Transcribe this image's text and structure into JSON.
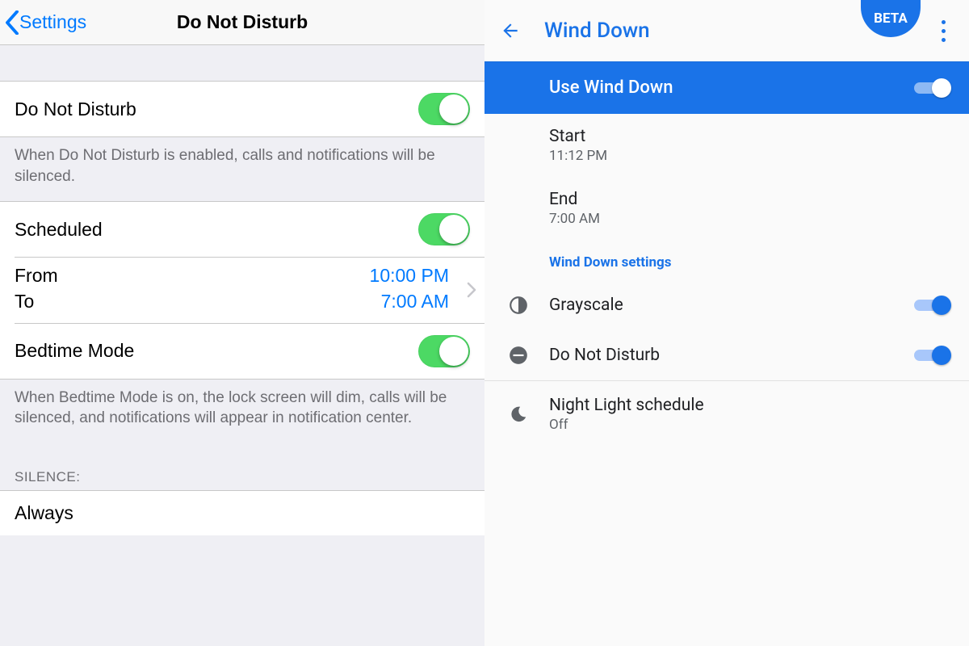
{
  "ios": {
    "back_label": "Settings",
    "title": "Do Not Disturb",
    "dnd": {
      "label": "Do Not Disturb",
      "on": true
    },
    "dnd_footer": "When Do Not Disturb is enabled, calls and notifications will be silenced.",
    "scheduled": {
      "label": "Scheduled",
      "on": true
    },
    "schedule": {
      "from_label": "From",
      "to_label": "To",
      "from": "10:00 PM",
      "to": "7:00 AM"
    },
    "bedtime": {
      "label": "Bedtime Mode",
      "on": true
    },
    "bedtime_footer": "When Bedtime Mode is on, the lock screen will dim, calls will be silenced, and notifications will appear in notification center.",
    "silence_header": "SILENCE:",
    "always_label": "Always"
  },
  "android": {
    "title": "Wind Down",
    "beta": "BETA",
    "banner": {
      "label": "Use Wind Down",
      "on": true
    },
    "start": {
      "label": "Start",
      "value": "11:12 PM"
    },
    "end": {
      "label": "End",
      "value": "7:00 AM"
    },
    "section_title": "Wind Down settings",
    "grayscale": {
      "label": "Grayscale",
      "on": true
    },
    "dnd": {
      "label": "Do Not Disturb",
      "on": true
    },
    "night_light": {
      "label": "Night Light schedule",
      "value": "Off"
    }
  }
}
